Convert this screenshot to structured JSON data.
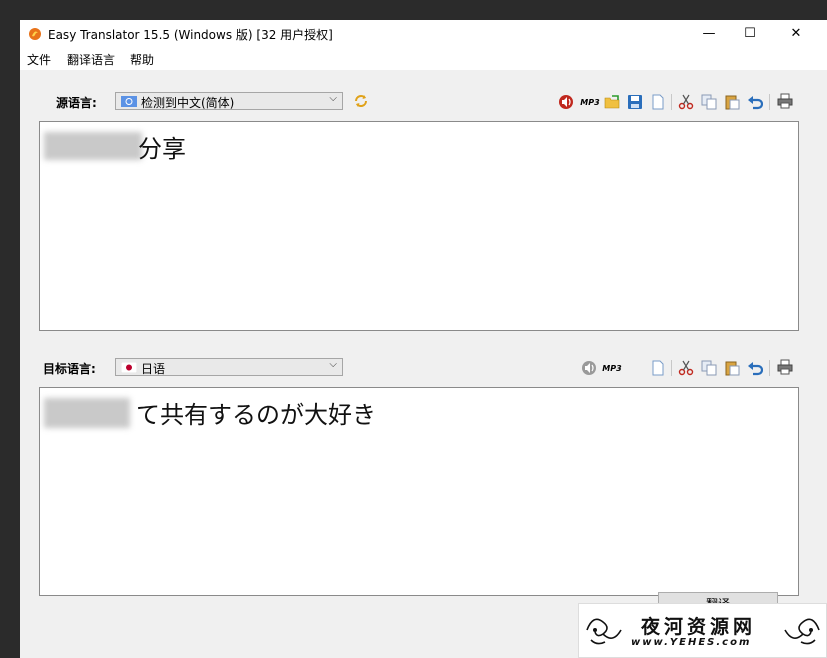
{
  "window": {
    "title": "Easy Translator 15.5 (Windows 版) [32 用户授权]",
    "controls": {
      "minimize": "—",
      "maximize": "☐",
      "close": "✕"
    }
  },
  "menu": [
    "文件",
    "翻译语言",
    "帮助"
  ],
  "source": {
    "label": "源语言:",
    "language": "检测到中文(简体)",
    "text": "分享",
    "toolbar_icons": [
      "speaker-icon",
      "mp3-icon",
      "open-folder-icon",
      "save-icon",
      "new-document-icon",
      "cut-icon",
      "copy-icon",
      "paste-icon",
      "undo-icon",
      "print-icon"
    ],
    "mp3_label": "MP3"
  },
  "target": {
    "label": "目标语言:",
    "language": "日语",
    "text": "て共有するのが大好き",
    "toolbar_icons": [
      "speaker-icon",
      "mp3-icon",
      "new-document-icon",
      "cut-icon",
      "copy-icon",
      "paste-icon",
      "undo-icon",
      "print-icon"
    ],
    "mp3_label": "MP3"
  },
  "translate_button": "翻译",
  "watermark": {
    "title": "夜河资源网",
    "url": "www.YEHES.com"
  },
  "colors": {
    "accent_red": "#c0281e",
    "icon_blue": "#2a6ebb",
    "flag_red": "#bc002d"
  }
}
